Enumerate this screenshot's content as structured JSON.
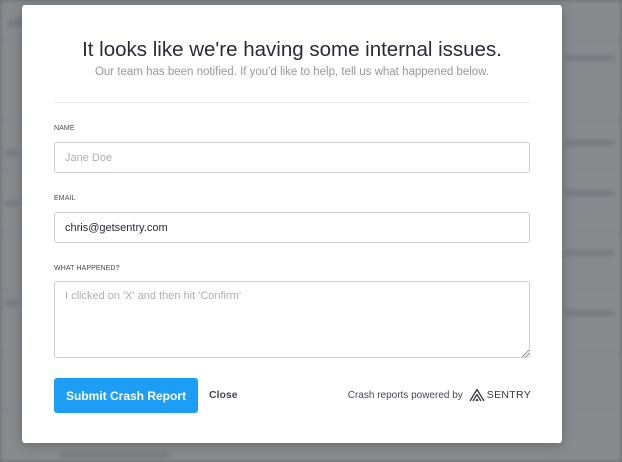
{
  "modal": {
    "title": "It looks like we're having some internal issues.",
    "subtitle": "Our team has been notified. If you'd like to help, tell us what happened below."
  },
  "form": {
    "name": {
      "label": "NAME",
      "placeholder": "Jane Doe",
      "value": ""
    },
    "email": {
      "label": "EMAIL",
      "placeholder": "",
      "value": "chris@getsentry.com"
    },
    "comments": {
      "label": "WHAT HAPPENED?",
      "placeholder": "I clicked on 'X' and then hit 'Confirm'",
      "value": ""
    }
  },
  "actions": {
    "submit_label": "Submit Crash Report",
    "close_label": "Close"
  },
  "footer": {
    "powered_text": "Crash reports powered by",
    "brand": "SENTRY",
    "brand_icon": "sentry-logo-icon"
  },
  "colors": {
    "accent": "#1d9ef6",
    "title": "#2f2936",
    "muted": "#9a96a1"
  }
}
